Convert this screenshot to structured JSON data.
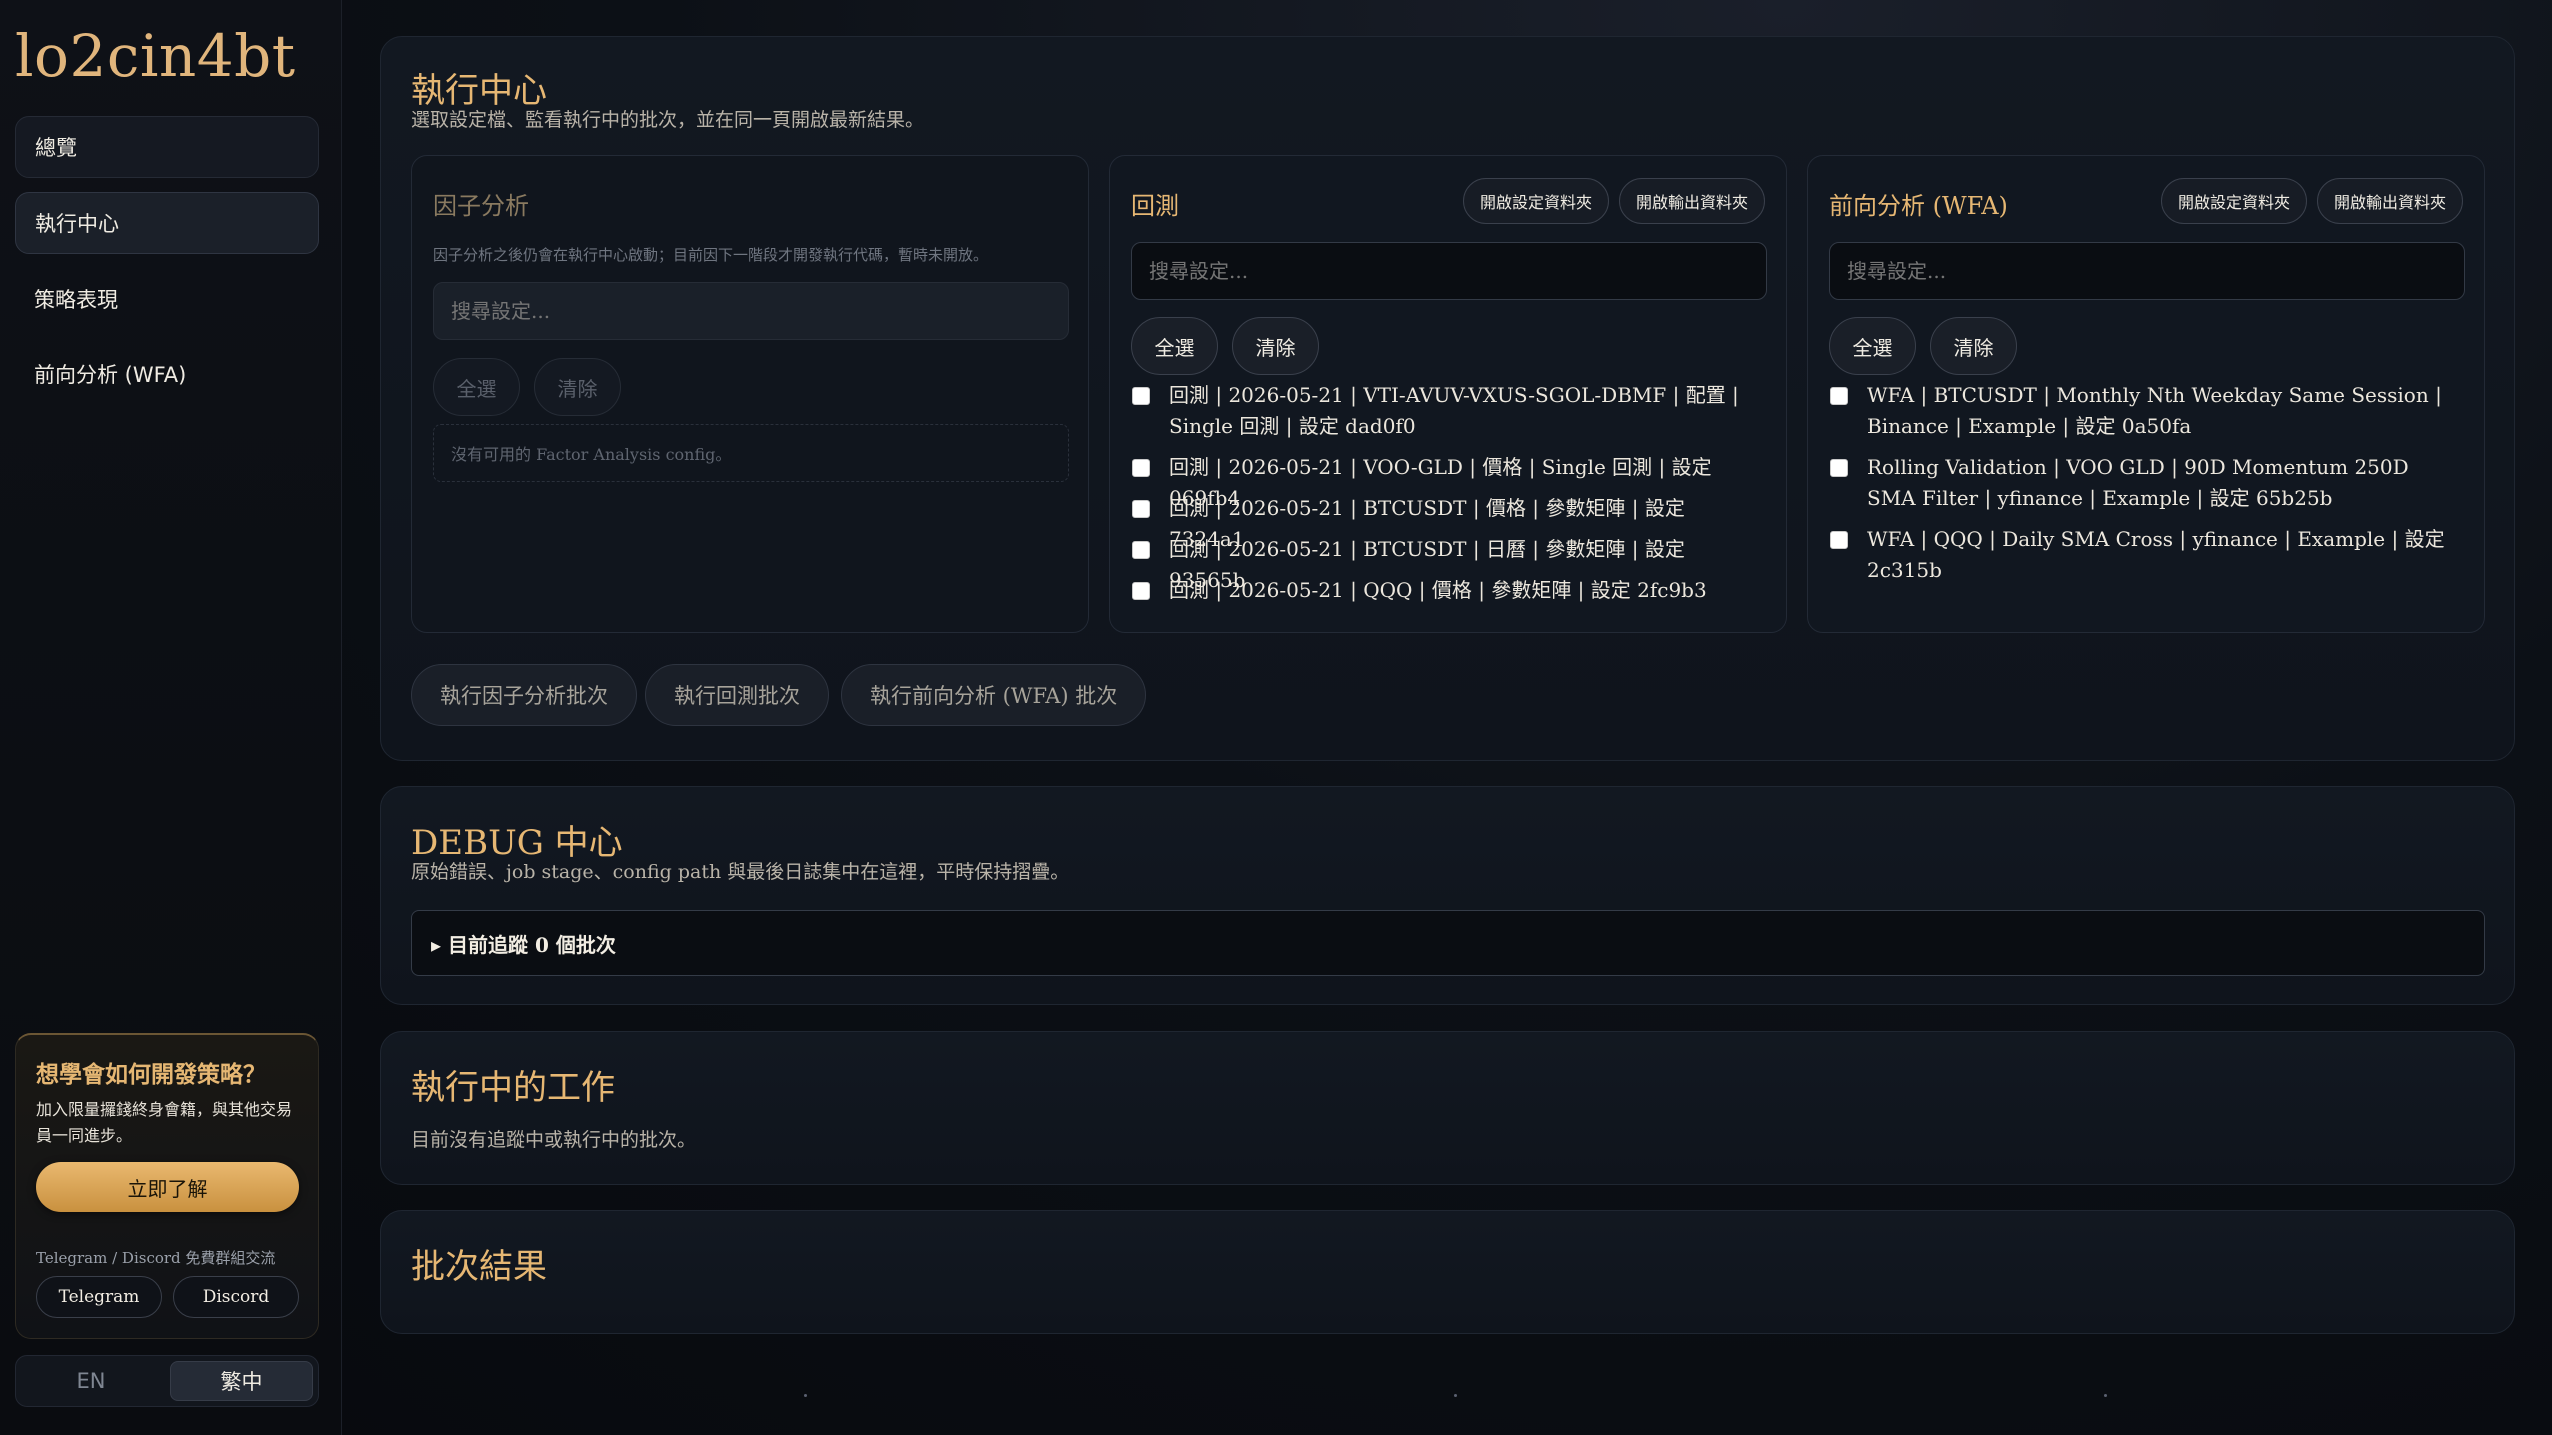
{
  "brand": "lo2cin4bt",
  "nav": [
    {
      "label": "總覽"
    },
    {
      "label": "執行中心"
    },
    {
      "label": "策略表現"
    },
    {
      "label": "前向分析 (WFA)"
    }
  ],
  "promo": {
    "title": "想學會如何開發策略？",
    "desc": "加入限量攞錢終身會籍，與其他交易員一同進步。",
    "cta": "立即了解",
    "community": "Telegram / Discord 免費群組交流",
    "telegram": "Telegram",
    "discord": "Discord"
  },
  "lang": {
    "en": "EN",
    "zh": "繁中"
  },
  "exec": {
    "title": "執行中心",
    "subtitle": "選取設定檔、監看執行中的批次，並在同一頁開啟最新結果。",
    "factor": {
      "title": "因子分析",
      "note": "因子分析之後仍會在執行中心啟動；目前因下一階段才開發執行代碼，暫時未開放。",
      "search_placeholder": "搜尋設定...",
      "select_all": "全選",
      "clear": "清除",
      "empty": "沒有可用的 Factor Analysis config。"
    },
    "backtest": {
      "title": "回測",
      "open_config": "開啟設定資料夾",
      "open_output": "開啟輸出資料夾",
      "search_placeholder": "搜尋設定...",
      "select_all": "全選",
      "clear": "清除",
      "items": [
        "回測 | 2026-05-21 | VTI-AVUV-VXUS-SGOL-DBMF | 配置 | Single 回測 | 設定 dad0f0",
        "回測 | 2026-05-21 | VOO-GLD | 價格 | Single 回測 | 設定 069fb4",
        "回測 | 2026-05-21 | BTCUSDT | 價格 | 參數矩陣 | 設定 7324a1",
        "回測 | 2026-05-21 | BTCUSDT | 日曆 | 參數矩陣 | 設定 93565b",
        "回測 | 2026-05-21 | QQQ | 價格 | 參數矩陣 | 設定 2fc9b3"
      ]
    },
    "wfa": {
      "title": "前向分析 (WFA)",
      "open_config": "開啟設定資料夾",
      "open_output": "開啟輸出資料夾",
      "search_placeholder": "搜尋設定...",
      "select_all": "全選",
      "clear": "清除",
      "items": [
        "WFA | BTCUSDT | Monthly Nth Weekday Same Session | Binance | Example | 設定 0a50fa",
        "Rolling Validation | VOO GLD | 90D Momentum 250D SMA Filter | yfinance | Example | 設定 65b25b",
        "WFA | QQQ | Daily SMA Cross | yfinance | Example | 設定 2c315b"
      ]
    },
    "run_factor": "執行因子分析批次",
    "run_backtest": "執行回測批次",
    "run_wfa": "執行前向分析 (WFA) 批次"
  },
  "debug": {
    "title": "DEBUG 中心",
    "subtitle": "原始錯誤、job stage、config path 與最後日誌集中在這裡，平時保持摺疊。",
    "summary": "▸ 目前追蹤 0 個批次"
  },
  "running": {
    "title": "執行中的工作",
    "empty": "目前沒有追蹤中或執行中的批次。"
  },
  "results": {
    "title": "批次結果"
  }
}
